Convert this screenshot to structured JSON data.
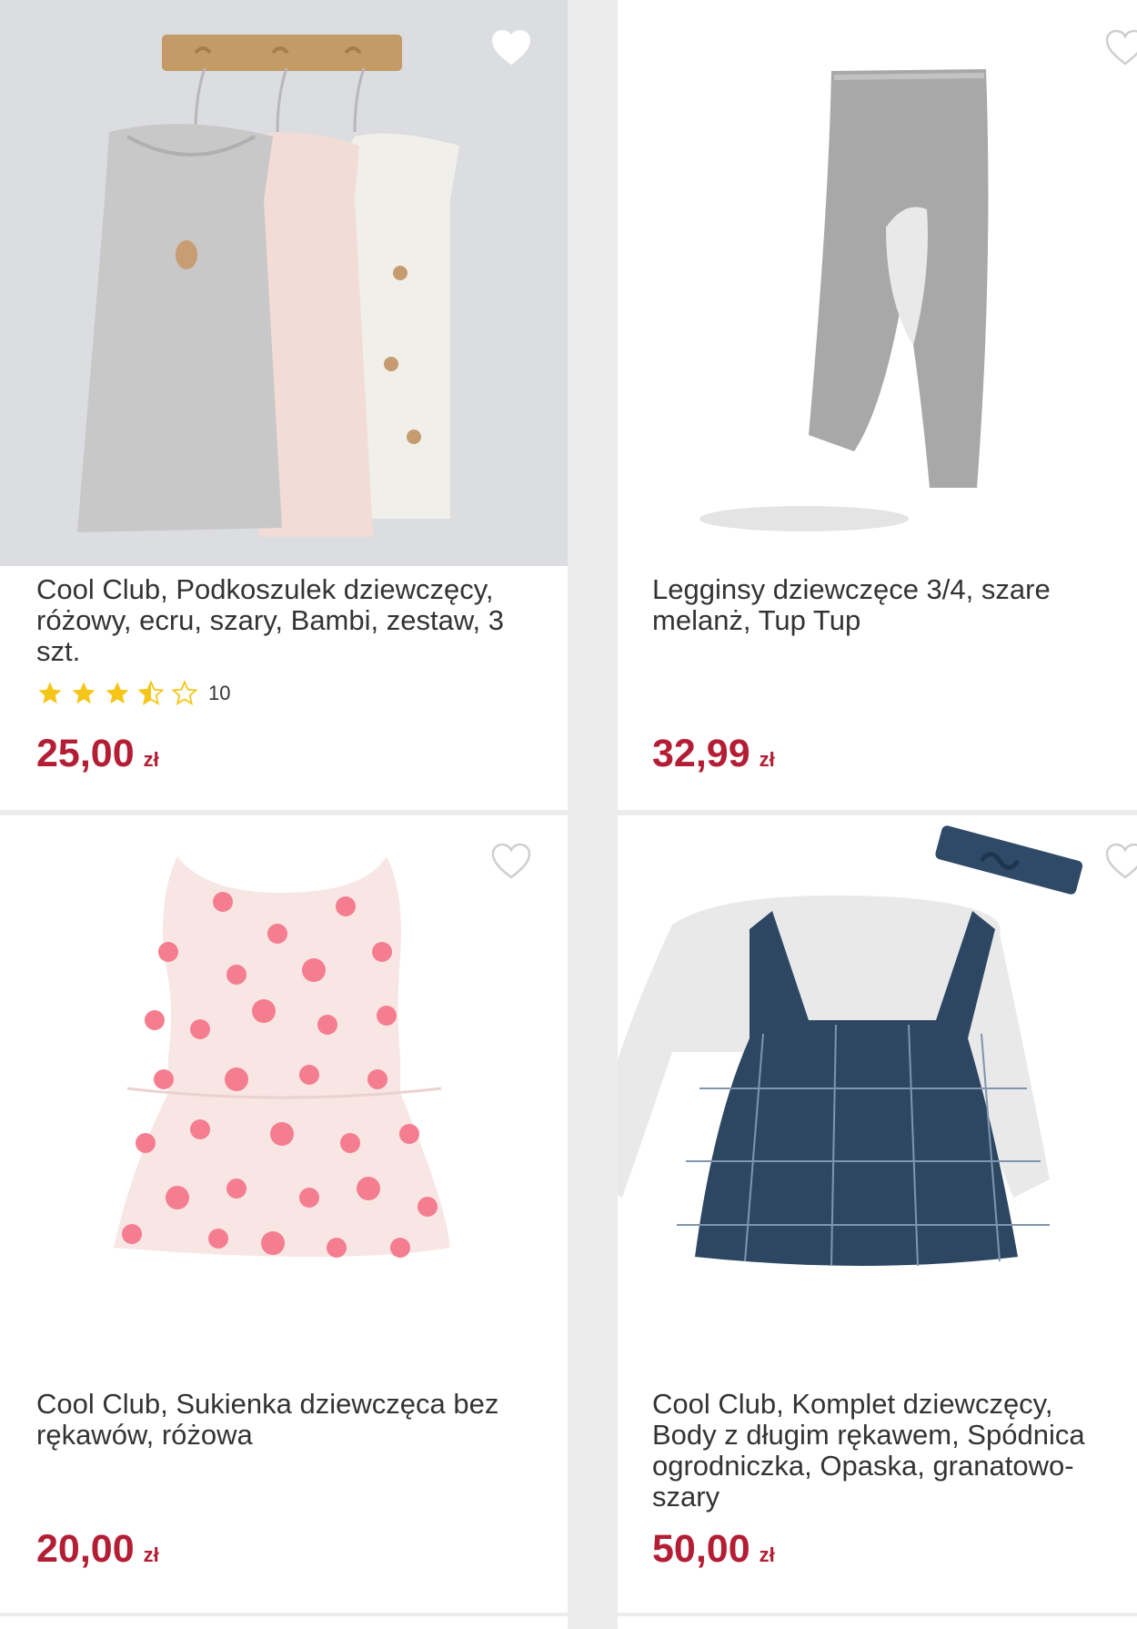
{
  "theme": {
    "price_color": "#b31e35",
    "star_color": "#f5c518",
    "heart_outline": "#cfcfcf"
  },
  "products": [
    {
      "title": "Cool Club, Podkoszulek dziewczęcy, różowy, ecru, szary, Bambi, zestaw, 3 szt.",
      "rating": 3.5,
      "rating_count": "10",
      "price": "25,00",
      "currency": "zł",
      "favorite_icon": "heart-filled-icon"
    },
    {
      "title": "Legginsy dziewczęce 3/4, szare melanż, Tup Tup",
      "price": "32,99",
      "currency": "zł",
      "favorite_icon": "heart-outline-icon"
    },
    {
      "title": "Cool Club, Sukienka dziewczęca bez rękawów, różowa",
      "price": "20,00",
      "currency": "zł",
      "favorite_icon": "heart-outline-icon"
    },
    {
      "title": "Cool Club, Komplet dziewczęcy, Body z długim rękawem, Spódnica ogrodniczka, Opaska, granatowo-szary",
      "price": "50,00",
      "currency": "zł",
      "favorite_icon": "heart-outline-icon"
    }
  ]
}
